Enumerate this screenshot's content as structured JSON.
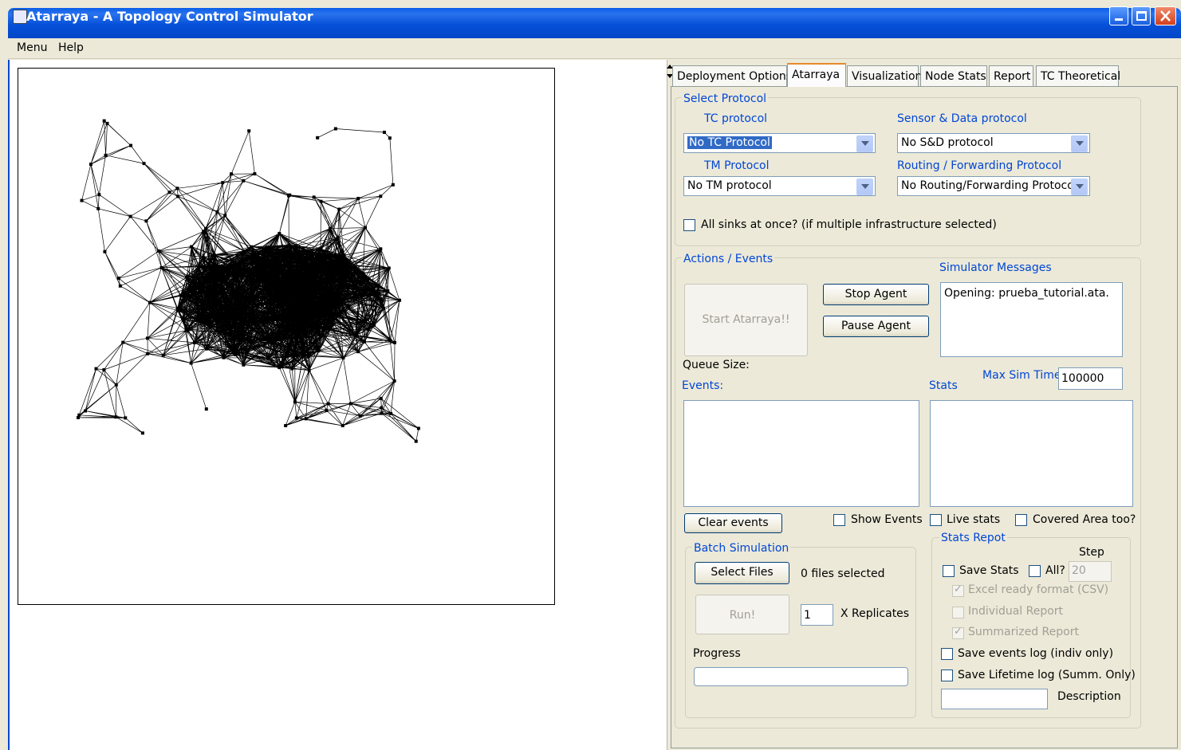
{
  "window": {
    "title": "Atarraya - A Topology Control Simulator"
  },
  "menu": [
    "Menu",
    "Help"
  ],
  "tabs": [
    "Deployment Options",
    "Atarraya",
    "Visualization",
    "Node Stats",
    "Report",
    "TC Theoretical"
  ],
  "active_tab": "Atarraya",
  "select_protocol": {
    "group_label": "Select Protocol",
    "tc_label": "TC protocol",
    "tc_value": "No TC Protocol",
    "sd_label": "Sensor & Data protocol",
    "sd_value": "No S&D protocol",
    "tm_label": "TM Protocol",
    "tm_value": "No TM protocol",
    "routing_label": "Routing / Forwarding Protocol",
    "routing_value": "No Routing/Forwarding Protocol",
    "all_sinks_label": "All sinks at once? (if multiple infrastructure selected)"
  },
  "actions": {
    "group_label": "Actions / Events",
    "start_label": "Start Atarraya!!",
    "stop_label": "Stop Agent",
    "pause_label": "Pause Agent",
    "sim_messages_label": "Simulator Messages",
    "sim_messages_text": "Opening: prueba_tutorial.ata.",
    "queue_size_label": "Queue Size:",
    "max_sim_time_label": "Max Sim Time",
    "max_sim_time_value": "100000",
    "events_label": "Events:",
    "stats_label": "Stats",
    "clear_events_label": "Clear events",
    "show_events_label": "Show Events",
    "live_stats_label": "Live stats",
    "covered_area_label": "Covered Area too?"
  },
  "batch": {
    "group_label": "Batch Simulation",
    "select_files_label": "Select Files",
    "files_selected_text": "0 files selected",
    "run_label": "Run!",
    "replicates_value": "1",
    "replicates_label": "X Replicates",
    "progress_label": "Progress",
    "progress_value": 0
  },
  "stats_report": {
    "group_label": "Stats Repot",
    "step_label": "Step",
    "save_stats_label": "Save Stats",
    "all_label": "All?",
    "step_value": "20",
    "excel_label": "Excel ready format (CSV)",
    "individual_label": "Individual Report",
    "summarized_label": "Summarized Report",
    "save_events_log_label": "Save events log (indiv only)",
    "save_lifetime_log_label": "Save Lifetime log (Summ. Only)",
    "description_label": "Description",
    "description_value": ""
  },
  "colors": {
    "accent": "#0046d5",
    "titlebar": "#0a5ee8",
    "panel_bg": "#ece9d8"
  }
}
